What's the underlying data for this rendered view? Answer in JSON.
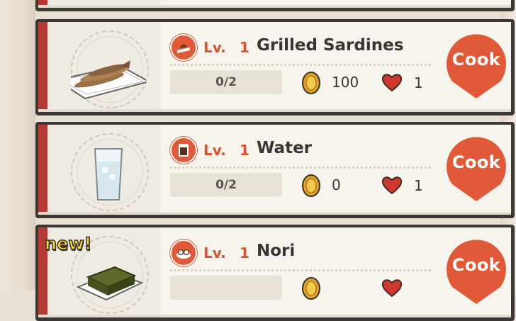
{
  "recipes": [
    {
      "level_label": "Lv.",
      "level": "1",
      "name": "Grilled Sardines",
      "progress": "0/2",
      "price": "100",
      "likes": "1",
      "cook_label": "Cook",
      "category_icon": "grill-icon",
      "dish_icon": "grilled-sardines-dish",
      "is_new": false
    },
    {
      "level_label": "Lv.",
      "level": "1",
      "name": "Water",
      "progress": "0/2",
      "price": "0",
      "likes": "1",
      "cook_label": "Cook",
      "category_icon": "drink-icon",
      "dish_icon": "water-glass",
      "is_new": false
    },
    {
      "level_label": "Lv.",
      "level": "1",
      "name": "Nori",
      "progress": "",
      "price": "",
      "likes": "",
      "cook_label": "Cook",
      "category_icon": "platter-icon",
      "dish_icon": "nori-dish",
      "is_new": true,
      "new_label": "new!"
    }
  ],
  "colors": {
    "accent": "#e05a3a",
    "stripe": "#b33a35",
    "frame": "#3b3836",
    "card": "#f7f4ee",
    "new_tag": "#f3d43a"
  }
}
